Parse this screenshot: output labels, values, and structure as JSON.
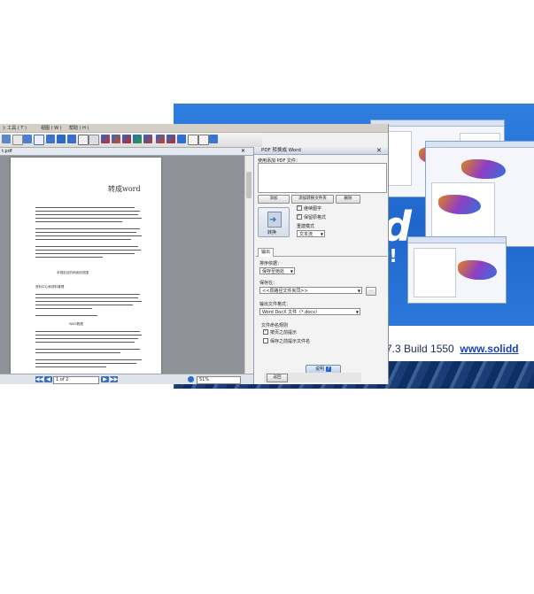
{
  "splash": {
    "glyph_large": "d",
    "glyph_small": "t!",
    "version_text": "7.3  Build 1550",
    "link_text": "www.solidd"
  },
  "app": {
    "menu": [
      "): 工具 ( T )",
      "视图 ( W )",
      "帮助 ( H )"
    ],
    "doc_tab": "t.pdf",
    "page_header": "转成word",
    "page_headings": [
      "本规定目的和适用范围",
      "资料中心和资料管理",
      "资料处理的要求",
      "WDS数据"
    ],
    "pager": {
      "first": "◀◀",
      "prev": "◀",
      "value": "1 of 2",
      "next": "▶",
      "last": "▶▶"
    },
    "zoom": "51%"
  },
  "panel": {
    "title": "PDF 转换成 Word",
    "files_label": "使用添加 PDF 文件：",
    "btn_add": "添加",
    "btn_add_folder": "添加转换文件夹",
    "btn_remove": "删除",
    "convert_label": "转换",
    "opt_show_image": "继续图字",
    "opt_keep_layout": "保留原格式",
    "opt_mode_label": "重建模式",
    "opt_mode_value": "文本流",
    "tab_output": "输出",
    "sort_label": "排序依据：",
    "sort_value": "保存至她处",
    "save_label": "保存在：",
    "save_value": "<<原路径文件夹同>>",
    "save_browse": "...",
    "format_label": "输出文件格式：",
    "format_value": "Word DocX 文件（*.docx）",
    "naming_label": "文件命名规则",
    "opt_auto_name": "按页之前提示",
    "opt_keep_name": "保存之前提示文件名",
    "help_label": "说明",
    "help_icon": "?",
    "back_label": "返回"
  },
  "colors": {
    "splash_blue": "#2a6fd0",
    "link": "#1b3fb5",
    "toolbar_accent": "#2e6ec9"
  }
}
